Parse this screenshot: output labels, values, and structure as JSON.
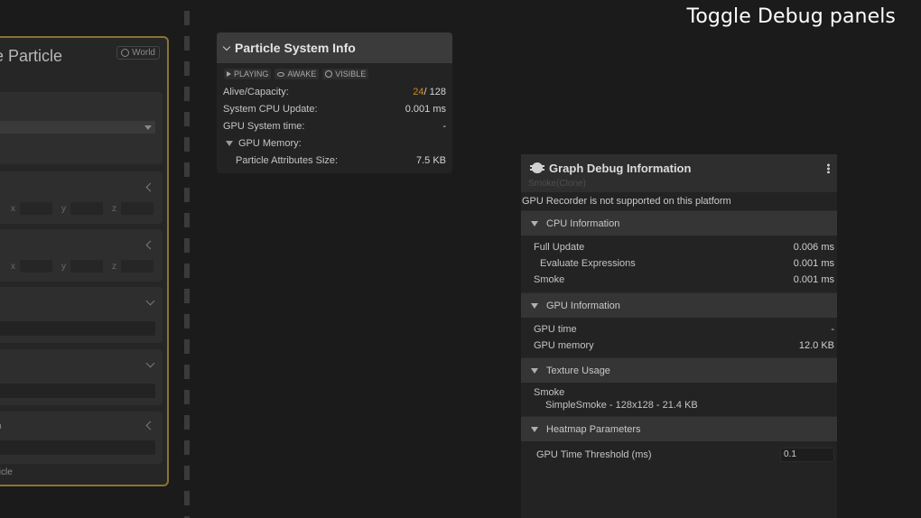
{
  "caption": "Toggle Debug panels",
  "context_node": {
    "title": "e Particle",
    "space_badge": "World",
    "dropdown_value": "al",
    "axis_labels": [
      "x",
      "y",
      "z"
    ],
    "fragment_label": "rm",
    "footer": "ticle"
  },
  "particle_info": {
    "title": "Particle System Info",
    "badges": [
      "PLAYING",
      "AWAKE",
      "VISIBLE"
    ],
    "alive_label": "Alive/Capacity:",
    "alive_value": "24",
    "capacity_value": "/ 128",
    "cpu_label": "System CPU Update:",
    "cpu_value": "0.001 ms",
    "gpu_time_label": "GPU System time:",
    "gpu_time_value": "-",
    "gpu_memory_label": "GPU Memory:",
    "attr_size_label": "Particle Attributes Size:",
    "attr_size_value": "7.5 KB"
  },
  "graph_debug": {
    "title": "Graph Debug Information",
    "subtitle": "Smoke(Clone)",
    "notice": "GPU Recorder is not supported on this platform",
    "cpu_section": "CPU Information",
    "cpu_rows": [
      {
        "label": "Full Update",
        "value": "0.006 ms"
      },
      {
        "label": "Evaluate Expressions",
        "value": "0.001 ms"
      },
      {
        "label": "Smoke",
        "value": "0.001 ms"
      }
    ],
    "gpu_section": "GPU Information",
    "gpu_rows": [
      {
        "label": "GPU time",
        "value": "-"
      },
      {
        "label": "GPU memory",
        "value": "12.0 KB"
      }
    ],
    "texture_section": "Texture Usage",
    "texture_owner": "Smoke",
    "texture_entry": "SimpleSmoke - 128x128 - 21.4 KB",
    "heatmap_section": "Heatmap Parameters",
    "threshold_label": "GPU Time Threshold (ms)",
    "threshold_value": "0.1"
  }
}
